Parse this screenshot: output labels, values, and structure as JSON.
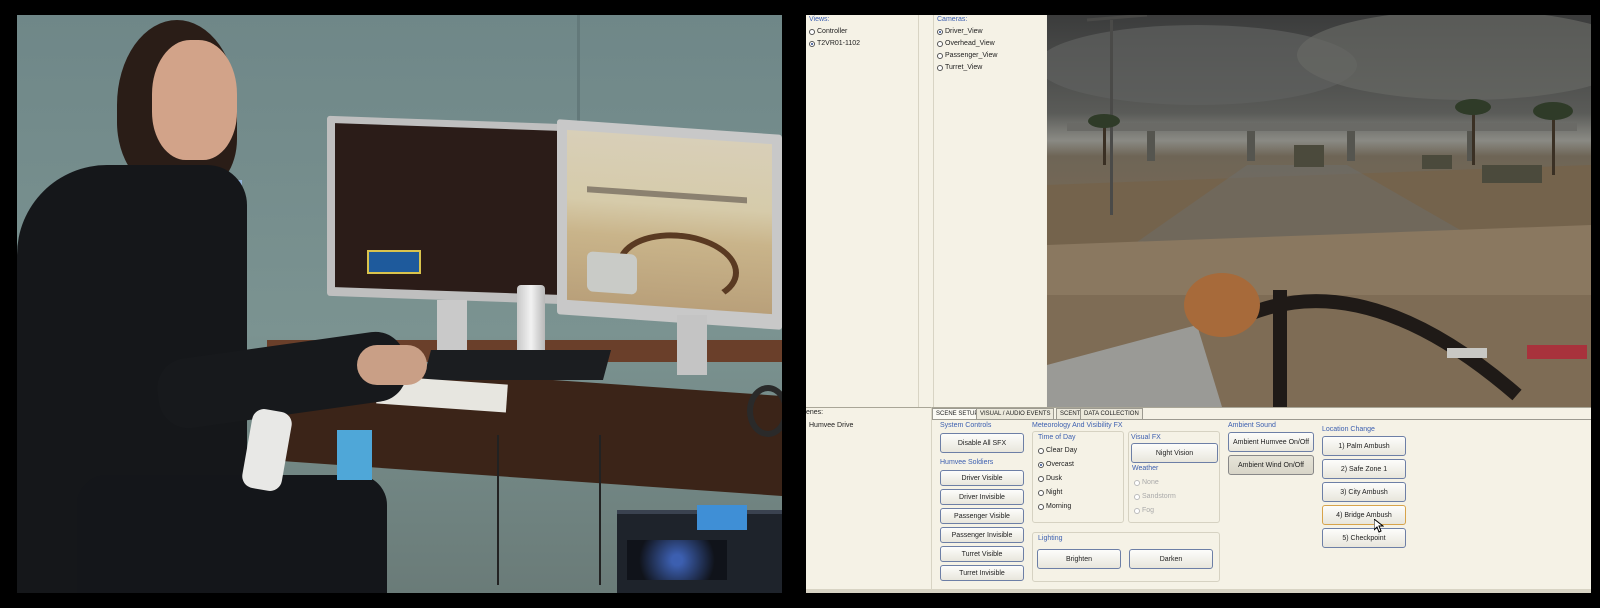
{
  "sim": {
    "views": {
      "title": "Views:",
      "items": [
        "Controller",
        "T2VR01-1102"
      ],
      "selected": 1
    },
    "cameras": {
      "title": "Cameras:",
      "items": [
        "Driver_View",
        "Overhead_View",
        "Passenger_View",
        "Turret_View"
      ],
      "selected": 0
    },
    "scenes": {
      "title": "enes:",
      "items": [
        "Humvee Drive"
      ]
    },
    "tabs": [
      "SCENE SETUP",
      "VISUAL / AUDIO EVENTS",
      "SCENT",
      "DATA COLLECTION"
    ],
    "active_tab": 0,
    "system_controls": {
      "title": "System Controls",
      "disable_sfx": "Disable All SFX"
    },
    "soldiers": {
      "title": "Humvee Soldiers",
      "buttons": [
        "Driver Visible",
        "Driver Invisible",
        "Passenger Visible",
        "Passenger Invisible",
        "Turret Visible",
        "Turret Invisible"
      ]
    },
    "meteorology": {
      "title": "Meteorology And Visibility FX",
      "time_of_day": {
        "title": "Time of Day",
        "items": [
          "Clear Day",
          "Overcast",
          "Dusk",
          "Night",
          "Morning"
        ],
        "selected": 1
      }
    },
    "visual_fx": {
      "title": "Visual FX",
      "night_vision": "Night Vision"
    },
    "weather": {
      "title": "Weather",
      "items": [
        "None",
        "Sandstorm",
        "Fog"
      ]
    },
    "lighting": {
      "title": "Lighting",
      "brighten": "Brighten",
      "darken": "Darken"
    },
    "ambient": {
      "title": "Ambient Sound",
      "humvee": "Ambient Humvee On/Off",
      "wind": "Ambient Wind On/Off"
    },
    "location": {
      "title": "Location Change",
      "buttons": [
        "1) Palm Ambush",
        "2) Safe Zone 1",
        "3) City Ambush",
        "4) Bridge Ambush",
        "5) Checkpoint"
      ]
    }
  },
  "icons": [
    "mouse-cursor-icon"
  ],
  "colors": {
    "section_title": "#3c5fb0",
    "panel": "#f5f2e6",
    "button_border": "#6d7fa6"
  }
}
